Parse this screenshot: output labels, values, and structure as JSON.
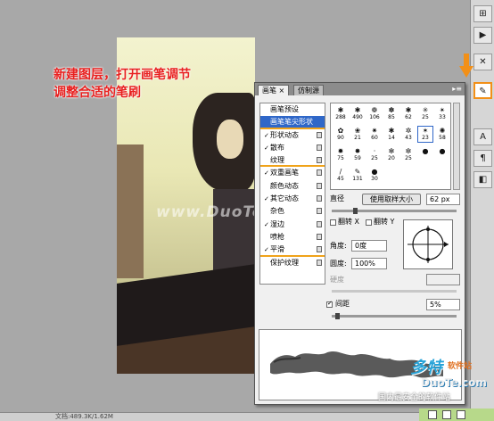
{
  "caption": {
    "line1": "新建图层，打开画笔调节",
    "line2": "调整合适的笔刷"
  },
  "watermark": "www.DuoTe.com",
  "statusbar": {
    "doc_info": "文档:489.3K/1.62M"
  },
  "panel": {
    "tabs": [
      {
        "label": "画笔",
        "close": "×"
      },
      {
        "label": "仿制源"
      }
    ],
    "menu_icon": "menu-icon",
    "presets": [
      {
        "label": "画笔预设",
        "checked": false,
        "locked": false
      },
      {
        "label": "画笔笔尖形状",
        "checked": false,
        "locked": false,
        "selected": true
      },
      {
        "label": "形状动态",
        "checked": true,
        "locked": true
      },
      {
        "label": "散布",
        "checked": true,
        "locked": true
      },
      {
        "label": "纹理",
        "checked": false,
        "locked": true
      },
      {
        "label": "双重画笔",
        "checked": true,
        "locked": true
      },
      {
        "label": "颜色动态",
        "checked": false,
        "locked": true
      },
      {
        "label": "其它动态",
        "checked": true,
        "locked": true
      },
      {
        "label": "杂色",
        "checked": false,
        "locked": true
      },
      {
        "label": "湿边",
        "checked": true,
        "locked": true
      },
      {
        "label": "喷枪",
        "checked": false,
        "locked": true
      },
      {
        "label": "平滑",
        "checked": true,
        "locked": true
      },
      {
        "label": "保护纹理",
        "checked": false,
        "locked": true
      }
    ],
    "brush_tips": [
      {
        "glyph": "✱",
        "size": "288"
      },
      {
        "glyph": "✱",
        "size": "490"
      },
      {
        "glyph": "❁",
        "size": "106"
      },
      {
        "glyph": "✽",
        "size": "85"
      },
      {
        "glyph": "✱",
        "size": "62"
      },
      {
        "glyph": "✳",
        "size": "25"
      },
      {
        "glyph": "✴",
        "size": "33"
      },
      {
        "glyph": "✿",
        "size": "90"
      },
      {
        "glyph": "❀",
        "size": "21"
      },
      {
        "glyph": "✷",
        "size": "60"
      },
      {
        "glyph": "✱",
        "size": "14"
      },
      {
        "glyph": "✲",
        "size": "43"
      },
      {
        "glyph": "✶",
        "size": "23"
      },
      {
        "glyph": "✺",
        "size": "58"
      },
      {
        "glyph": "✹",
        "size": "75"
      },
      {
        "glyph": "✸",
        "size": "59"
      },
      {
        "glyph": "·",
        "size": "25"
      },
      {
        "glyph": "✻",
        "size": "20"
      },
      {
        "glyph": "✼",
        "size": "25"
      },
      {
        "glyph": "●",
        "size": ""
      },
      {
        "glyph": "●",
        "size": ""
      },
      {
        "glyph": "/",
        "size": "45"
      },
      {
        "glyph": "✎",
        "size": "131"
      },
      {
        "glyph": "●",
        "size": "30"
      }
    ],
    "diameter": {
      "label": "直径",
      "button": "使用取样大小",
      "value": "62 px"
    },
    "flip": {
      "x_label": "翻转 X",
      "y_label": "翻转 Y"
    },
    "angle": {
      "label": "角度:",
      "value": "0度"
    },
    "roundness": {
      "label": "圆度:",
      "value": "100%"
    },
    "hardness": {
      "label": "硬度"
    },
    "spacing": {
      "label": "间距",
      "value": "5%",
      "checked": true
    }
  },
  "dock": {
    "buttons": [
      {
        "icon": "history-icon",
        "glyph": "⊞"
      },
      {
        "icon": "actions-icon",
        "glyph": "▶"
      },
      {
        "icon": "tools-icon",
        "glyph": "✕"
      },
      {
        "icon": "brush-panel-icon",
        "glyph": "✎",
        "active": true
      },
      {
        "icon": "character-icon",
        "glyph": "A"
      },
      {
        "icon": "paragraph-icon",
        "glyph": "¶"
      },
      {
        "icon": "layers-icon",
        "glyph": "◧"
      }
    ]
  },
  "logo": {
    "main": "多特",
    "sub": "软件站",
    "domain": "DuoTe.com",
    "tagline": "国内最安全的软件站"
  },
  "colors": {
    "caption": "#e8201f",
    "selection": "#2f67c8",
    "accent": "#f29018"
  }
}
